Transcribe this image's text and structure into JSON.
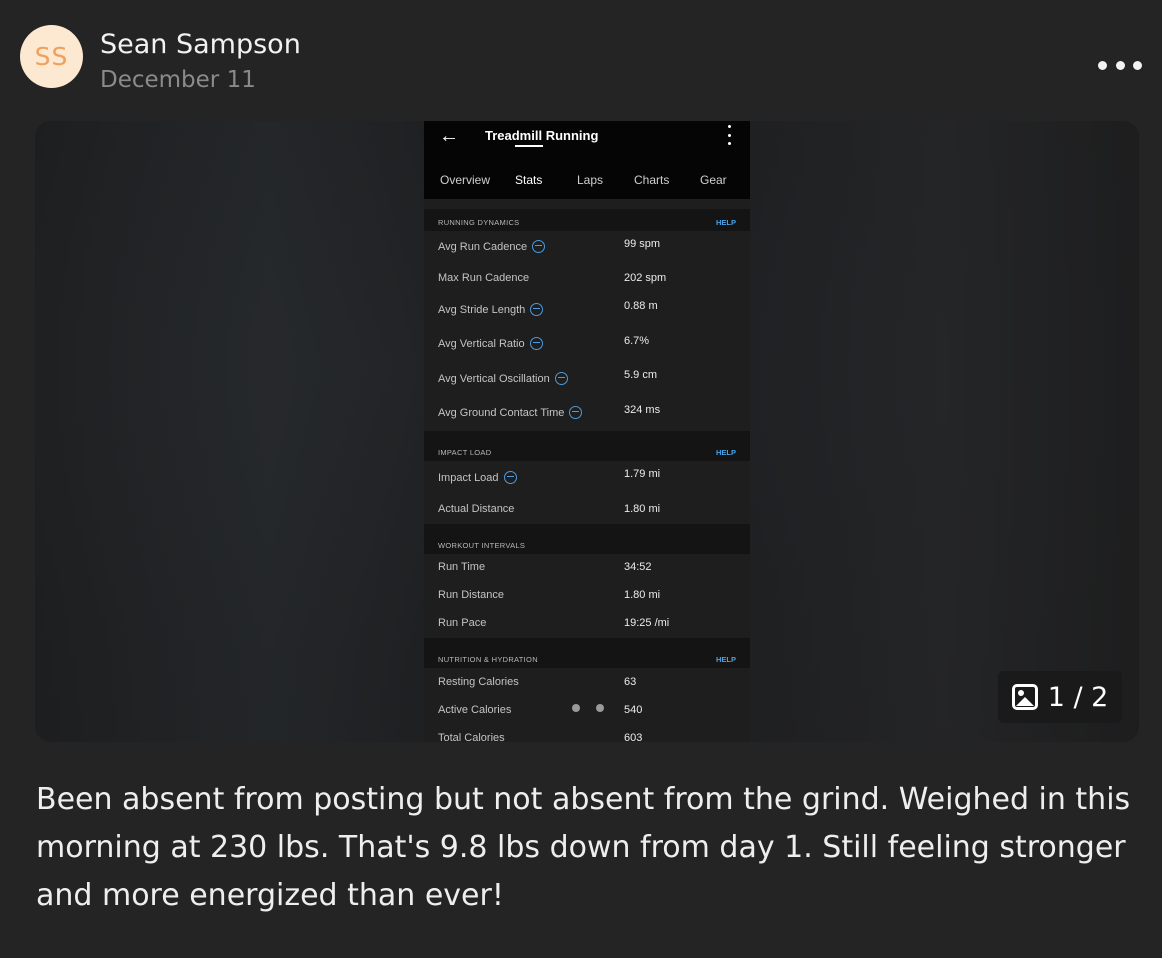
{
  "post": {
    "avatar_initials": "SS",
    "author": "Sean Sampson",
    "date": "December 11",
    "caption": "Been absent from posting but not absent from the grind. Weighed in this morning at 230 lbs. That's 9.8 lbs down from day 1. Still feeling stronger and more energized than ever!",
    "media_counter": "1 / 2"
  },
  "screenshot": {
    "title": "Treadmill Running",
    "tabs": [
      "Overview",
      "Stats",
      "Laps",
      "Charts",
      "Gear"
    ],
    "active_tab": "Stats",
    "help_label": "HELP",
    "sections": {
      "running_dynamics": {
        "title": "RUNNING DYNAMICS",
        "rows": [
          {
            "label": "Avg Run Cadence",
            "value": "99 spm"
          },
          {
            "label": "Max Run Cadence",
            "value": "202 spm"
          },
          {
            "label": "Avg Stride Length",
            "value": "0.88 m"
          },
          {
            "label": "Avg Vertical Ratio",
            "value": "6.7%"
          },
          {
            "label": "Avg Vertical Oscillation",
            "value": "5.9 cm"
          },
          {
            "label": "Avg Ground Contact Time",
            "value": "324 ms"
          }
        ]
      },
      "impact_load": {
        "title": "IMPACT LOAD",
        "rows": [
          {
            "label": "Impact Load",
            "value": "1.79 mi"
          },
          {
            "label": "Actual Distance",
            "value": "1.80 mi"
          }
        ]
      },
      "workout_intervals": {
        "title": "WORKOUT INTERVALS",
        "rows": [
          {
            "label": "Run Time",
            "value": "34:52"
          },
          {
            "label": "Run Distance",
            "value": "1.80 mi"
          },
          {
            "label": "Run Pace",
            "value": "19:25 /mi"
          }
        ]
      },
      "nutrition": {
        "title": "NUTRITION & HYDRATION",
        "rows": [
          {
            "label": "Resting Calories",
            "value": "63"
          },
          {
            "label": "Active Calories",
            "value": "540"
          },
          {
            "label": "Total Calories",
            "value": "603"
          }
        ]
      }
    }
  },
  "icons": {
    "more": "more-horizontal-icon",
    "back": "arrow-left-icon",
    "kebab": "more-vertical-icon",
    "info": "activity-info-icon",
    "image": "image-icon"
  },
  "colors": {
    "background": "#242424",
    "avatar_bg": "#fde8d2",
    "avatar_text": "#f0a05a",
    "help_link": "#4aa3e8"
  }
}
